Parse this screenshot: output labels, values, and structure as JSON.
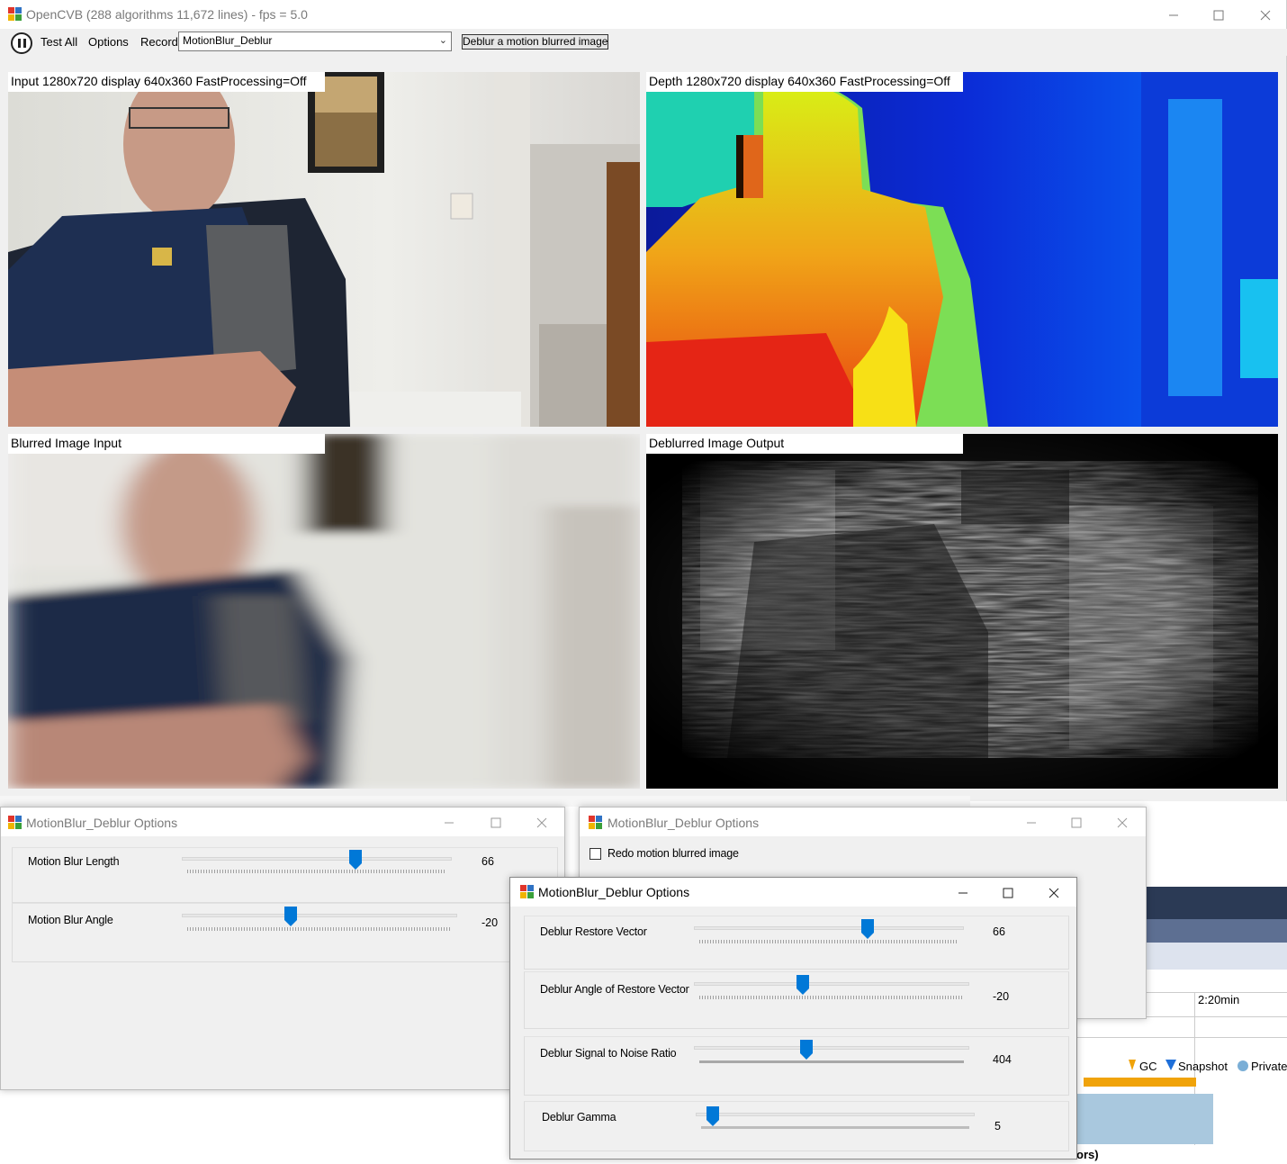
{
  "main": {
    "title": "OpenCVB (288 algorithms 11,672 lines) - fps = 5.0",
    "toolbar": {
      "test_all": "Test All",
      "options": "Options",
      "record": "Record",
      "algorithm_selected": "MotionBlur_Deblur",
      "description": "Deblur a motion blurred image"
    },
    "panels": {
      "input": "Input 1280x720 display 640x360 FastProcessing=Off",
      "depth": "Depth 1280x720 display 640x360 FastProcessing=Off",
      "blurred": "Blurred Image Input",
      "deblurred": "Deblurred Image Output"
    }
  },
  "options1": {
    "title": "MotionBlur_Deblur Options",
    "sliders": [
      {
        "label": "Motion Blur Length",
        "value": "66"
      },
      {
        "label": "Motion Blur Angle",
        "value": "-20"
      }
    ]
  },
  "options2": {
    "title": "MotionBlur_Deblur Options",
    "checkbox_label": "Redo motion blurred image"
  },
  "options3": {
    "title": "MotionBlur_Deblur Options",
    "sliders": [
      {
        "label": "Deblur Restore Vector",
        "value": "66"
      },
      {
        "label": "Deblur Angle of Restore Vector",
        "value": "-20"
      },
      {
        "label": "Deblur Signal to Noise Ratio",
        "value": "404"
      },
      {
        "label": "Deblur Gamma",
        "value": "5"
      }
    ]
  },
  "profiler": {
    "time": "2:20min",
    "legend_gc": "GC",
    "legend_snapshot": "Snapshot",
    "legend_private": "Private",
    "footer": "ors)"
  },
  "colors": {
    "accent": "#0078d7",
    "window_bg": "#f0f0f0",
    "gc_marker": "#f0a30a",
    "snapshot_marker": "#1e6fd9",
    "private_marker": "#7aaed6"
  }
}
